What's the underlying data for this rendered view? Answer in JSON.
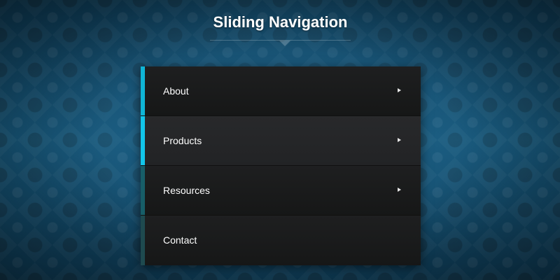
{
  "header": {
    "title": "Sliding Navigation"
  },
  "nav": {
    "items": [
      {
        "label": "About",
        "has_submenu": true,
        "active": false,
        "accent_color": "#0fb5d6"
      },
      {
        "label": "Products",
        "has_submenu": true,
        "active": true,
        "accent_color": "#12c6ea"
      },
      {
        "label": "Resources",
        "has_submenu": true,
        "active": false,
        "accent_color": "#175e68"
      },
      {
        "label": "Contact",
        "has_submenu": false,
        "active": false,
        "accent_color": "#1e4a4f"
      }
    ]
  },
  "icons": {
    "submenu": "triangle-right-icon",
    "title_pointer": "caret-down-icon"
  },
  "colors": {
    "background": "#14506f",
    "menu_bg": "#1c1d1e",
    "menu_active_bg": "#252628",
    "text": "#ffffff"
  }
}
